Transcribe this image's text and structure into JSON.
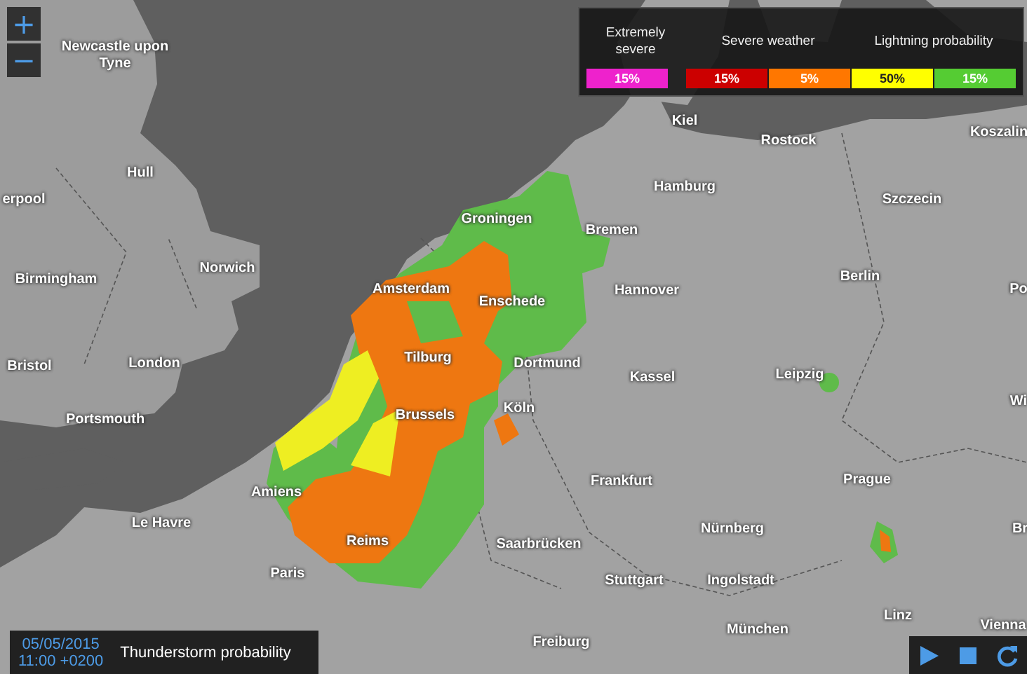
{
  "zoom_controls": [
    {
      "label": "+"
    },
    {
      "label": "−"
    }
  ],
  "legend": {
    "groups": [
      {
        "label": "Extremely severe",
        "cells": [
          {
            "value": "15%",
            "color": "#ee22cc"
          }
        ]
      },
      {
        "label": "Severe weather",
        "cells": [
          {
            "value": "15%",
            "color": "#cc0000"
          },
          {
            "value": "5%",
            "color": "#ff7700"
          }
        ]
      },
      {
        "label": "Lightning probability",
        "cells": [
          {
            "value": "50%",
            "color": "#ffff00"
          },
          {
            "value": "15%",
            "color": "#55cc33"
          }
        ]
      }
    ]
  },
  "cities": [
    "Newcastle upon Tyne",
    "Kiel",
    "Rostock",
    "Koszalin",
    "Hull",
    "Hamburg",
    "Szczecin",
    "erpool",
    "Groningen",
    "Bremen",
    "Norwich",
    "Birmingham",
    "Berlin",
    "Amsterdam",
    "Hannover",
    "Po",
    "Enschede",
    "Bristol",
    "London",
    "Tilburg",
    "Dortmund",
    "Kassel",
    "Leipzig",
    "Köln",
    "Wi",
    "Brussels",
    "Portsmouth",
    "Frankfurt",
    "Prague",
    "Amiens",
    "Le Havre",
    "Nürnberg",
    "Br",
    "Reims",
    "Saarbrücken",
    "Paris",
    "Stuttgart",
    "Ingolstadt",
    "Linz",
    "Vienna",
    "München",
    "Freiburg"
  ],
  "info_panel": {
    "date": "05/05/2015",
    "time": "11:00 +0200",
    "title": "Thunderstorm probability"
  },
  "playback": [
    {
      "kind": "play"
    },
    {
      "kind": "stop"
    },
    {
      "kind": "refresh"
    }
  ]
}
